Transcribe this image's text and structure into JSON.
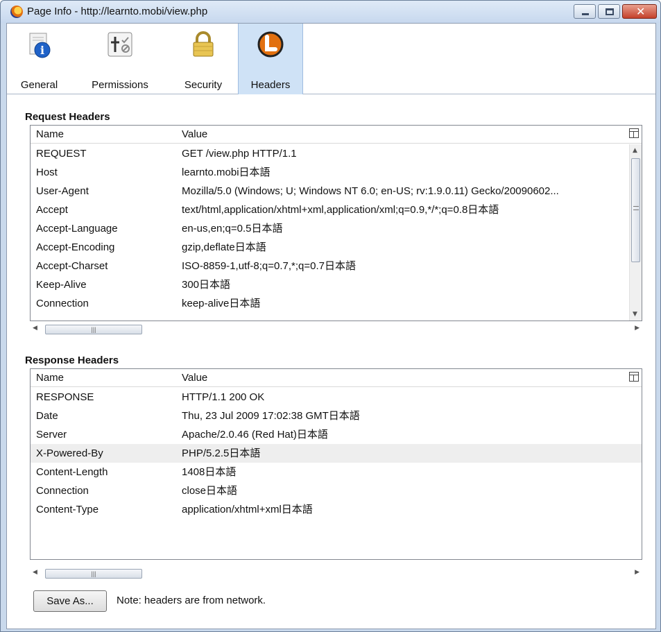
{
  "window": {
    "title": "Page Info - http://learnto.mobi/view.php",
    "controls": {
      "minimize": "minimize",
      "maximize": "maximize",
      "close": "✕"
    }
  },
  "toolbar": {
    "tabs": [
      {
        "label": "General",
        "icon": "info-icon"
      },
      {
        "label": "Permissions",
        "icon": "permissions-icon"
      },
      {
        "label": "Security",
        "icon": "lock-icon"
      },
      {
        "label": "Headers",
        "icon": "headers-icon",
        "selected": true
      }
    ]
  },
  "request": {
    "title": "Request Headers",
    "columns": {
      "name": "Name",
      "value": "Value"
    },
    "rows": [
      {
        "name": "REQUEST",
        "value": "GET /view.php HTTP/1.1"
      },
      {
        "name": "Host",
        "value": "learnto.mobi日本語"
      },
      {
        "name": "User-Agent",
        "value": "Mozilla/5.0 (Windows; U; Windows NT 6.0; en-US; rv:1.9.0.11) Gecko/20090602..."
      },
      {
        "name": "Accept",
        "value": "text/html,application/xhtml+xml,application/xml;q=0.9,*/*;q=0.8日本語"
      },
      {
        "name": "Accept-Language",
        "value": "en-us,en;q=0.5日本語"
      },
      {
        "name": "Accept-Encoding",
        "value": "gzip,deflate日本語"
      },
      {
        "name": "Accept-Charset",
        "value": "ISO-8859-1,utf-8;q=0.7,*;q=0.7日本語"
      },
      {
        "name": "Keep-Alive",
        "value": "300日本語"
      },
      {
        "name": "Connection",
        "value": "keep-alive日本語"
      }
    ]
  },
  "response": {
    "title": "Response Headers",
    "columns": {
      "name": "Name",
      "value": "Value"
    },
    "rows": [
      {
        "name": "RESPONSE",
        "value": "HTTP/1.1 200 OK"
      },
      {
        "name": "Date",
        "value": "Thu, 23 Jul 2009 17:02:38 GMT日本語"
      },
      {
        "name": "Server",
        "value": "Apache/2.0.46 (Red Hat)日本語"
      },
      {
        "name": "X-Powered-By",
        "value": "PHP/5.2.5日本語"
      },
      {
        "name": "Content-Length",
        "value": "1408日本語"
      },
      {
        "name": "Connection",
        "value": "close日本語"
      },
      {
        "name": "Content-Type",
        "value": "application/xhtml+xml日本語"
      }
    ]
  },
  "footer": {
    "save_label": "Save As...",
    "note": "Note: headers are from network."
  },
  "colors": {
    "title_bar": "#c7d8ee",
    "selected_tab": "#cfe2f6",
    "highlight_row": "#eeeeee"
  }
}
